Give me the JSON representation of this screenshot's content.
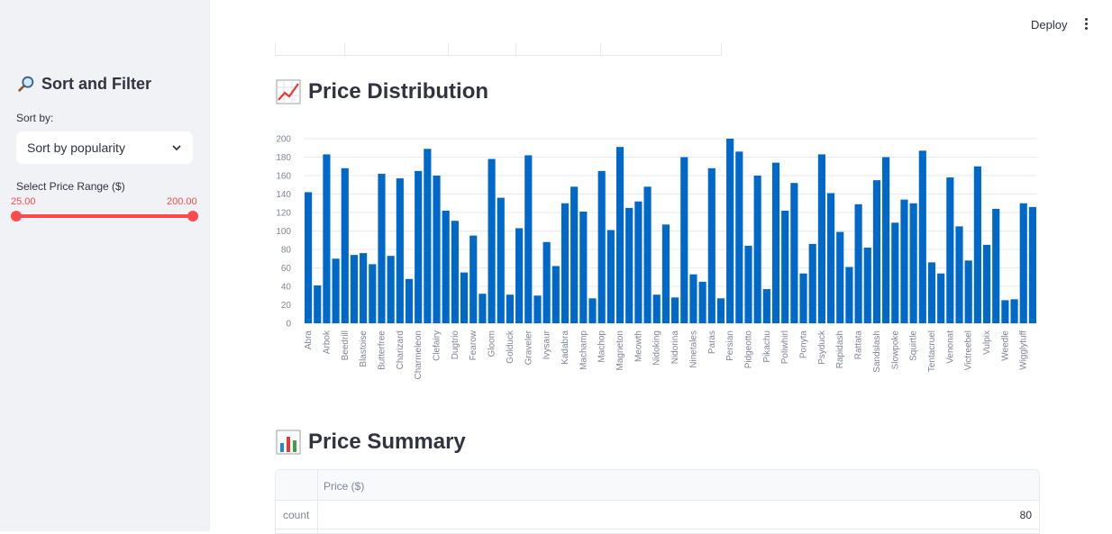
{
  "header": {
    "deploy_label": "Deploy"
  },
  "sidebar": {
    "title": "Sort and Filter",
    "sort_label": "Sort by:",
    "sort_value": "Sort by popularity",
    "price_range_label": "Select Price Range ($)",
    "range_min": "25.00",
    "range_max": "200.00"
  },
  "sections": {
    "distribution_title": "Price Distribution",
    "summary_title": "Price Summary"
  },
  "summary_table": {
    "column_header": "Price ($)",
    "rows": [
      {
        "label": "count",
        "value": "80"
      }
    ]
  },
  "colors": {
    "bar": "#0068c9",
    "accent": "#ff4b4b",
    "sidebar_bg": "#f0f2f6"
  },
  "chart_data": {
    "type": "bar",
    "ylim": [
      0,
      200
    ],
    "yticks": [
      0,
      20,
      40,
      60,
      80,
      100,
      120,
      140,
      160,
      180,
      200
    ],
    "grid": true,
    "values": [
      142,
      41,
      183,
      70,
      168,
      74,
      76,
      64,
      162,
      73,
      157,
      48,
      165,
      189,
      160,
      122,
      111,
      55,
      95,
      32,
      178,
      136,
      31,
      103,
      182,
      30,
      88,
      62,
      130,
      148,
      121,
      27,
      165,
      101,
      191,
      125,
      132,
      148,
      31,
      107,
      28,
      180,
      53,
      45,
      168,
      27,
      200,
      186,
      84,
      160,
      37,
      174,
      122,
      152,
      54,
      86,
      183,
      141,
      99,
      61,
      129,
      82,
      155,
      180,
      109,
      134,
      130,
      187,
      66,
      54,
      158,
      105,
      68,
      170,
      85,
      124,
      25,
      26,
      130,
      126
    ],
    "categories": [
      "Abra",
      "",
      "Arbok",
      "",
      "Beedrill",
      "",
      "Blastoise",
      "",
      "Butterfree",
      "",
      "Charizard",
      "",
      "Charmeleon",
      "",
      "Clefairy",
      "",
      "Dugtrio",
      "",
      "Fearow",
      "",
      "Gloom",
      "",
      "Golduck",
      "",
      "Graveler",
      "",
      "Ivysaur",
      "",
      "Kadabra",
      "",
      "Machamp",
      "",
      "Machop",
      "",
      "Magneton",
      "",
      "Meowth",
      "",
      "Nidoking",
      "",
      "Nidorina",
      "",
      "Ninetales",
      "",
      "Paras",
      "",
      "Persian",
      "",
      "Pidgeotto",
      "",
      "Pikachu",
      "",
      "Poliwhirl",
      "",
      "Ponyta",
      "",
      "Psyduck",
      "",
      "Rapidash",
      "",
      "Rattata",
      "",
      "Sandslash",
      "",
      "Slowpoke",
      "",
      "Squirtle",
      "",
      "Tentacruel",
      "",
      "Venonat",
      "",
      "Victreebel",
      "",
      "Vulpix",
      "",
      "Weedle",
      "",
      "Wigglytuff",
      ""
    ]
  }
}
